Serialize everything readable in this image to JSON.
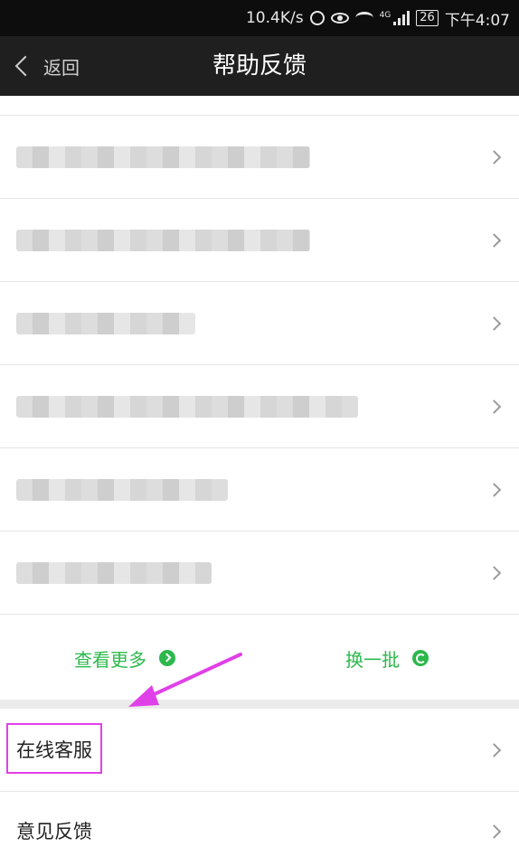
{
  "status_bar": {
    "net_speed": "10.4K/s",
    "network_type": "4G",
    "battery": "26",
    "time": "下午4:07",
    "icons": [
      "alarm-icon",
      "eye-icon",
      "wifi-icon",
      "signal-icon",
      "battery-icon"
    ]
  },
  "nav": {
    "back_label": "返回",
    "title": "帮助反馈"
  },
  "faq": {
    "items": [
      {
        "label": "",
        "blurred": true,
        "has_orange_mark": true
      },
      {
        "label": "",
        "blurred": true,
        "has_orange_mark": true
      },
      {
        "label": "",
        "blurred": true,
        "has_orange_mark": false
      },
      {
        "label": "",
        "blurred": true,
        "has_orange_mark": false
      },
      {
        "label": "",
        "blurred": true,
        "has_orange_mark": false
      },
      {
        "label": "",
        "blurred": true,
        "has_orange_mark": false
      }
    ],
    "view_more_label": "查看更多",
    "refresh_label": "换一批"
  },
  "menu": {
    "online_service_label": "在线客服",
    "feedback_label": "意见反馈"
  },
  "colors": {
    "accent_green": "#2db84d",
    "annotation_magenta": "#e040e8",
    "nav_bg": "#1f1f1f"
  }
}
